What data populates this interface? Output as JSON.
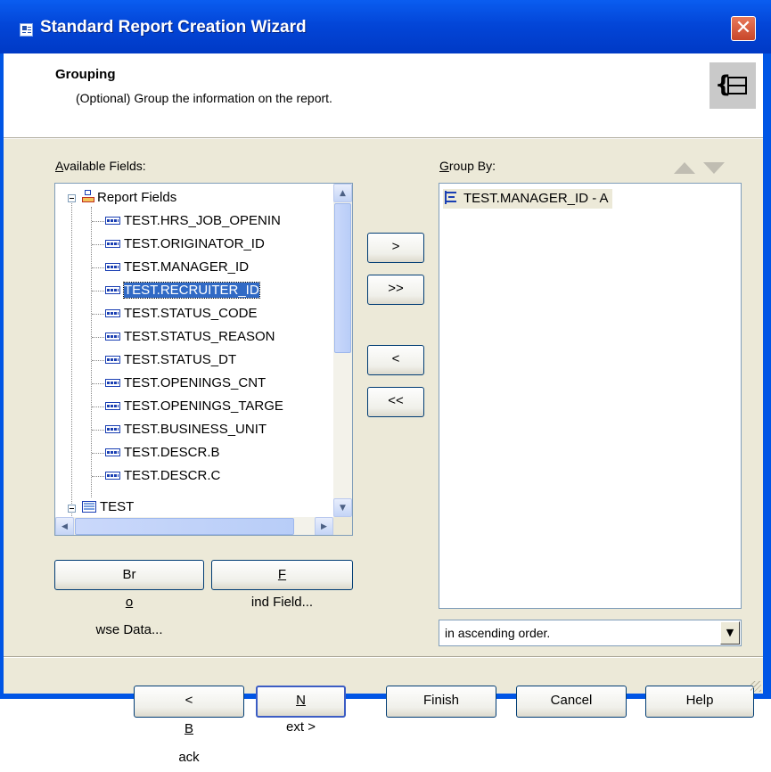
{
  "window": {
    "title": "Standard Report Creation Wizard",
    "close_icon": "close-icon"
  },
  "header": {
    "title": "Grouping",
    "subtitle": "(Optional) Group the information on the report."
  },
  "available": {
    "label_u": "A",
    "label_rest": "vailable Fields:",
    "root": "Report Fields",
    "fields": [
      "TEST.HRS_JOB_OPENIN",
      "TEST.ORIGINATOR_ID",
      "TEST.MANAGER_ID",
      "TEST.RECRUITER_ID",
      "TEST.STATUS_CODE",
      "TEST.STATUS_REASON",
      "TEST.STATUS_DT",
      "TEST.OPENINGS_CNT",
      "TEST.OPENINGS_TARGE",
      "TEST.BUSINESS_UNIT",
      "TEST.DESCR.B",
      "TEST.DESCR.C"
    ],
    "selected_index": 3,
    "table": "TEST"
  },
  "transfer": {
    "add": ">",
    "add_all": ">>",
    "remove": "<",
    "remove_all": "<<"
  },
  "buttons_left": {
    "browse_pre": "Br",
    "browse_u": "o",
    "browse_post": "wse Data...",
    "find_u": "F",
    "find_post": "ind Field..."
  },
  "groupby": {
    "label_u": "G",
    "label_rest": "roup By:",
    "items": [
      "TEST.MANAGER_ID - A"
    ],
    "order_value": "in ascending order."
  },
  "footer": {
    "back_pre": "< ",
    "back_u": "B",
    "back_post": "ack",
    "next_u": "N",
    "next_post": "ext >",
    "finish": "Finish",
    "cancel": "Cancel",
    "help": "Help"
  },
  "colors": {
    "selection": "#316ac5",
    "titlebar": "#0346d8",
    "dialog_bg": "#ece9d8"
  }
}
